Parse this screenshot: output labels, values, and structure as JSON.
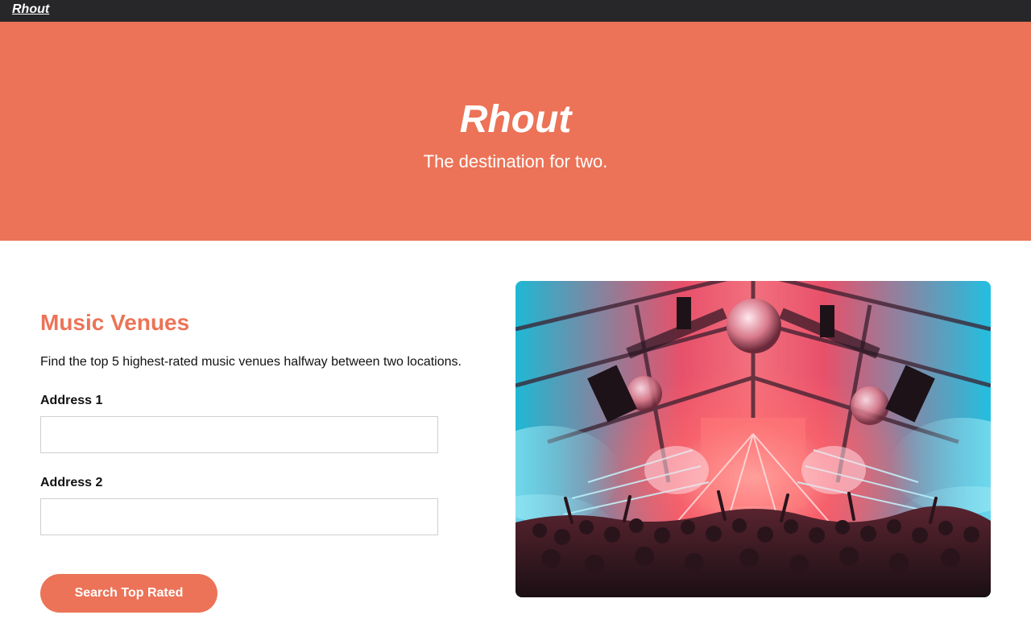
{
  "nav": {
    "brand": "Rhout"
  },
  "hero": {
    "title": "Rhout",
    "subtitle": "The destination for two."
  },
  "venues": {
    "title": "Music Venues",
    "description": "Find the top 5 highest-rated music venues halfway between two locations.",
    "address1_label": "Address 1",
    "address1_value": "",
    "address2_label": "Address 2",
    "address2_value": "",
    "search_label": "Search Top Rated"
  },
  "colors": {
    "accent": "#ec7357",
    "navbar": "#27272a"
  },
  "image": {
    "subject": "concert-crowd-photo"
  }
}
